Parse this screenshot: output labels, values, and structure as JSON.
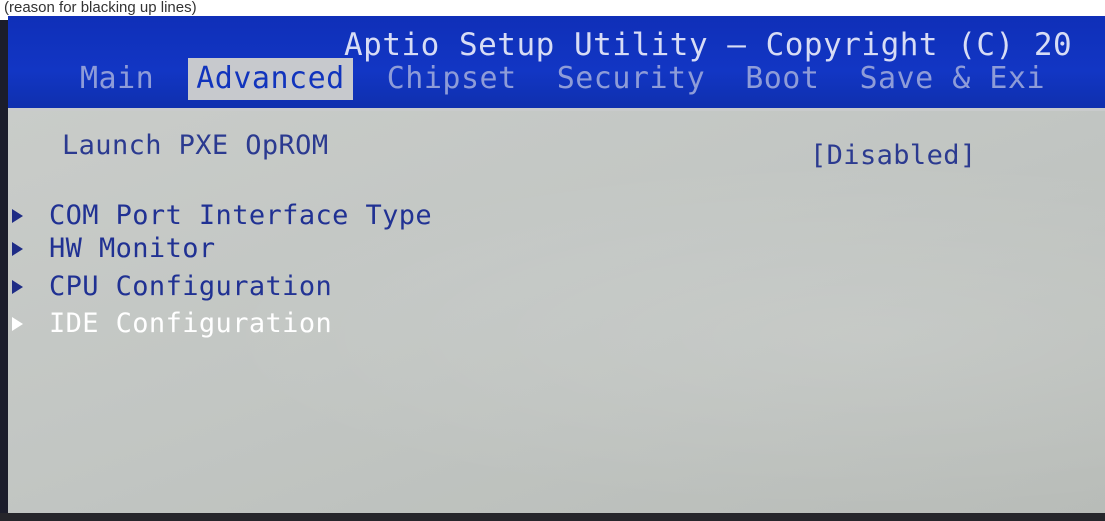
{
  "caption": "(reason for blacking up lines)",
  "title": "Aptio Setup Utility – Copyright (C) 20",
  "tabs": [
    {
      "label": "Main",
      "active": false
    },
    {
      "label": "Advanced",
      "active": true
    },
    {
      "label": "Chipset",
      "active": false
    },
    {
      "label": "Security",
      "active": false
    },
    {
      "label": "Boot",
      "active": false
    },
    {
      "label": "Save & Exi",
      "active": false
    }
  ],
  "settings": {
    "launch_pxe_label": "Launch PXE OpROM",
    "launch_pxe_value": "[Disabled]"
  },
  "submenus": [
    {
      "label": "COM Port Interface Type",
      "selected": false
    },
    {
      "label": "HW Monitor",
      "selected": false
    },
    {
      "label": "CPU Configuration",
      "selected": false
    },
    {
      "label": "IDE Configuration",
      "selected": true
    }
  ],
  "colors": {
    "header_blue": "#1236c4",
    "body_gray": "#c2c6c3",
    "option_text": "#2b3a90",
    "active_tab_bg": "#c7c9cd",
    "selected_item": "#ffffff"
  },
  "icons": {
    "submenu_marker": "triangle-right-icon"
  }
}
